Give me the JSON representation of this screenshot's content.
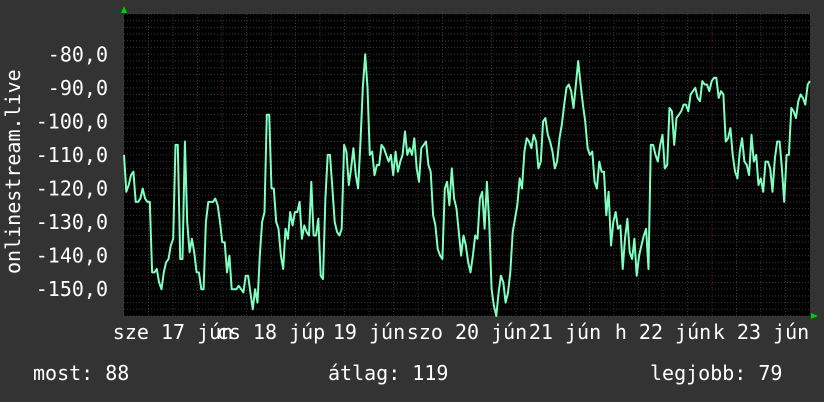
{
  "chart_data": {
    "type": "line",
    "ylabel": "onlinestream.live",
    "ylim": [
      -158,
      -68
    ],
    "yticks": [
      -80,
      -90,
      -100,
      -110,
      -120,
      -130,
      -140,
      -150
    ],
    "ytick_labels": [
      "-80,0",
      "-90,0",
      "-100,0",
      "-110,0",
      "-120,0",
      "-130,0",
      "-140,0",
      "-150,0"
    ],
    "xlim": [
      0,
      7
    ],
    "xtick_labels": [
      {
        "x": 0.5,
        "label": "sze 17 jún"
      },
      {
        "x": 1.5,
        "label": "cs 18 júp"
      },
      {
        "x": 2.5,
        "label": "19 jún"
      },
      {
        "x": 3.5,
        "label": "szo 20 jún"
      },
      {
        "x": 4.5,
        "label": "21 jún"
      },
      {
        "x": 5.5,
        "label": "h 22 jún"
      },
      {
        "x": 6.5,
        "label": "k 23 jún"
      }
    ],
    "grid": true,
    "colors": {
      "background": "#333333",
      "plot_background": "#000000",
      "grid": "#3a3a3a",
      "day_line": "#5a2a2a",
      "line": "#7fffc0",
      "axis_arrow": "#00cc00"
    },
    "series": [
      {
        "values": [
          -110,
          -121,
          -119,
          -116,
          -115,
          -124,
          -124,
          -123,
          -120,
          -123,
          -124,
          -124,
          -145,
          -145,
          -144,
          -148,
          -150,
          -145,
          -142,
          -141,
          -137,
          -135,
          -107,
          -107,
          -141,
          -141,
          -106,
          -130,
          -139,
          -135,
          -139,
          -145,
          -145,
          -150,
          -150,
          -130,
          -124,
          -124,
          -124,
          -123,
          -125,
          -130,
          -136,
          -136,
          -145,
          -140,
          -150,
          -150,
          -150,
          -149,
          -150,
          -151,
          -146,
          -146,
          -151,
          -156,
          -150,
          -154,
          -140,
          -130,
          -127,
          -98,
          -98,
          -120,
          -120,
          -130,
          -132,
          -140,
          -144,
          -132,
          -135,
          -127,
          -131,
          -127,
          -127,
          -124,
          -135,
          -131,
          -133,
          -134,
          -118,
          -134,
          -134,
          -129,
          -146,
          -147,
          -123,
          -110,
          -110,
          -120,
          -130,
          -133,
          -134,
          -132,
          -107,
          -109,
          -119,
          -114,
          -108,
          -116,
          -120,
          -106,
          -90,
          -80,
          -90,
          -110,
          -109,
          -116,
          -113,
          -113,
          -107,
          -108,
          -110,
          -112,
          -110,
          -116,
          -109,
          -115,
          -112,
          -110,
          -103,
          -110,
          -108,
          -110,
          -105,
          -114,
          -118,
          -108,
          -107,
          -106,
          -113,
          -115,
          -128,
          -131,
          -138,
          -140,
          -141,
          -120,
          -118,
          -125,
          -114,
          -123,
          -126,
          -133,
          -140,
          -134,
          -137,
          -142,
          -145,
          -140,
          -134,
          -135,
          -123,
          -121,
          -132,
          -118,
          -130,
          -150,
          -155,
          -158,
          -151,
          -146,
          -148,
          -154,
          -151,
          -145,
          -133,
          -129,
          -125,
          -117,
          -120,
          -109,
          -105,
          -106,
          -108,
          -104,
          -106,
          -114,
          -112,
          -100,
          -99,
          -104,
          -106,
          -109,
          -114,
          -112,
          -105,
          -101,
          -95,
          -90,
          -89,
          -91,
          -96,
          -89,
          -82,
          -89,
          -95,
          -100,
          -108,
          -110,
          -109,
          -118,
          -120,
          -112,
          -115,
          -115,
          -128,
          -121,
          -137,
          -130,
          -127,
          -132,
          -131,
          -144,
          -135,
          -129,
          -139,
          -141,
          -135,
          -146,
          -140,
          -137,
          -134,
          -132,
          -144,
          -107,
          -107,
          -110,
          -112,
          -107,
          -104,
          -114,
          -113,
          -96,
          -97,
          -107,
          -99,
          -98,
          -97,
          -95,
          -95,
          -97,
          -92,
          -91,
          -90,
          -93,
          -94,
          -88,
          -89,
          -89,
          -91,
          -88,
          -87,
          -87,
          -93,
          -91,
          -92,
          -106,
          -105,
          -102,
          -110,
          -115,
          -117,
          -109,
          -105,
          -112,
          -113,
          -116,
          -104,
          -112,
          -110,
          -119,
          -117,
          -121,
          -112,
          -112,
          -114,
          -121,
          -111,
          -106,
          -106,
          -114,
          -124,
          -110,
          -110,
          -96,
          -97,
          -99,
          -94,
          -92,
          -93,
          -95,
          -89,
          -88
        ]
      }
    ]
  },
  "stats": {
    "current": "most: 88",
    "average": "átlag: 119",
    "best": "legjobb: 79"
  }
}
